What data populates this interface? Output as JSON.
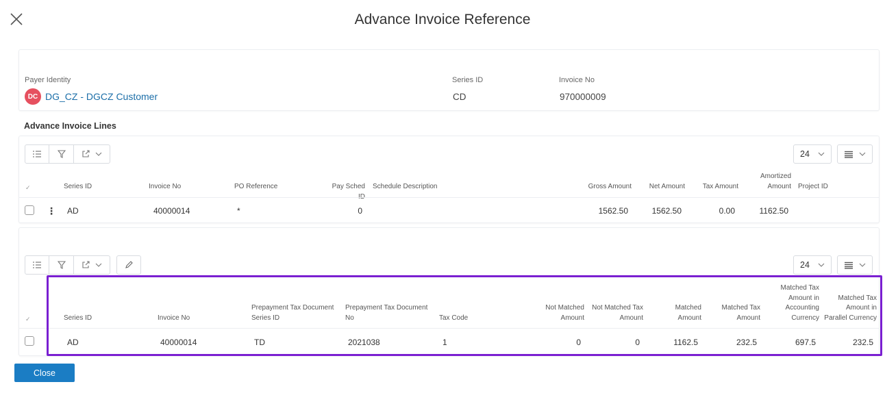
{
  "dialog": {
    "title": "Advance Invoice Reference",
    "close_button_label": "Close"
  },
  "header": {
    "payer_identity_label": "Payer Identity",
    "payer_avatar": "DC",
    "payer_value": "DG_CZ - DGCZ Customer",
    "series_id_label": "Series ID",
    "series_id_value": "CD",
    "invoice_no_label": "Invoice No",
    "invoice_no_value": "970000009"
  },
  "colors": {
    "accent": "#1b7dc4",
    "link": "#1b6ea8",
    "avatar": "#e6505f",
    "highlight": "#7a1fd1"
  },
  "lines_section": {
    "title": "Advance Invoice Lines",
    "page_size": "24",
    "columns": {
      "series_id": "Series ID",
      "invoice_no": "Invoice No",
      "po_reference": "PO Reference",
      "pay_sched_id": "Pay Sched ID",
      "schedule_description": "Schedule Description",
      "gross_amount": "Gross Amount",
      "net_amount": "Net Amount",
      "tax_amount": "Tax Amount",
      "amortized_l1": "Amortized",
      "amortized_l2": "Amount",
      "project_id": "Project ID"
    },
    "rows": [
      {
        "series_id": "AD",
        "invoice_no": "40000014",
        "po_reference": "*",
        "pay_sched_id": "0",
        "schedule_description": "",
        "gross_amount": "1562.50",
        "net_amount": "1562.50",
        "tax_amount": "0.00",
        "amortized_amount": "1162.50",
        "project_id": ""
      }
    ]
  },
  "tax_section": {
    "page_size": "24",
    "columns": {
      "series_id": "Series ID",
      "invoice_no": "Invoice No",
      "prepay_series_l1": "Prepayment Tax Document",
      "prepay_series_l2": "Series ID",
      "prepay_no_l1": "Prepayment Tax Document",
      "prepay_no_l2": "No",
      "tax_code": "Tax Code",
      "not_matched_amount_l1": "Not Matched",
      "not_matched_amount_l2": "Amount",
      "not_matched_tax_l1": "Not Matched Tax",
      "not_matched_tax_l2": "Amount",
      "matched_amount_l1": "Matched",
      "matched_amount_l2": "Amount",
      "matched_tax_l1": "Matched Tax",
      "matched_tax_l2": "Amount",
      "matched_acc_l1": "Matched Tax",
      "matched_acc_l2": "Amount in",
      "matched_acc_l3": "Accounting",
      "matched_acc_l4": "Currency",
      "matched_par_l1": "Matched Tax",
      "matched_par_l2": "Amount in",
      "matched_par_l3": "Parallel Currency"
    },
    "rows": [
      {
        "series_id": "AD",
        "invoice_no": "40000014",
        "prepay_series": "TD",
        "prepay_no": "2021038",
        "tax_code": "1",
        "not_matched_amount": "0",
        "not_matched_tax": "0",
        "matched_amount": "1162.5",
        "matched_tax": "232.5",
        "matched_acc": "697.5",
        "matched_par": "232.5"
      }
    ]
  },
  "icons": {
    "close": "close-icon",
    "list": "list-icon",
    "filter": "filter-icon",
    "export": "export-icon",
    "chevron": "chevron-down-icon",
    "columns": "column-layout-icon",
    "edit": "pencil-icon",
    "kebab": "more-vertical-icon",
    "check": "check-icon"
  }
}
